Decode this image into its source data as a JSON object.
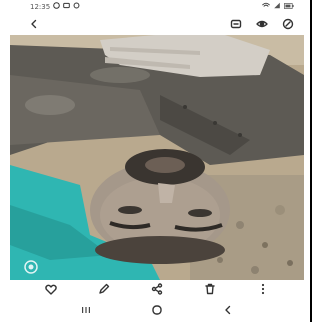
{
  "status": {
    "time": "12:35",
    "signal_text": "()"
  },
  "icons": {
    "back": "back-arrow-icon",
    "edit_photo": "edit-photo-icon",
    "view": "eye-icon",
    "remaster": "remaster-icon",
    "lens": "lens-icon",
    "favorite": "heart-icon",
    "edit": "pencil-icon",
    "share": "share-icon",
    "delete": "trash-icon",
    "more": "more-vertical-icon",
    "recents": "recents-icon",
    "home": "home-icon",
    "nav_back": "nav-back-icon"
  },
  "colors": {
    "accent": "#2f2f2f",
    "tarp": "#2cb6b4"
  }
}
